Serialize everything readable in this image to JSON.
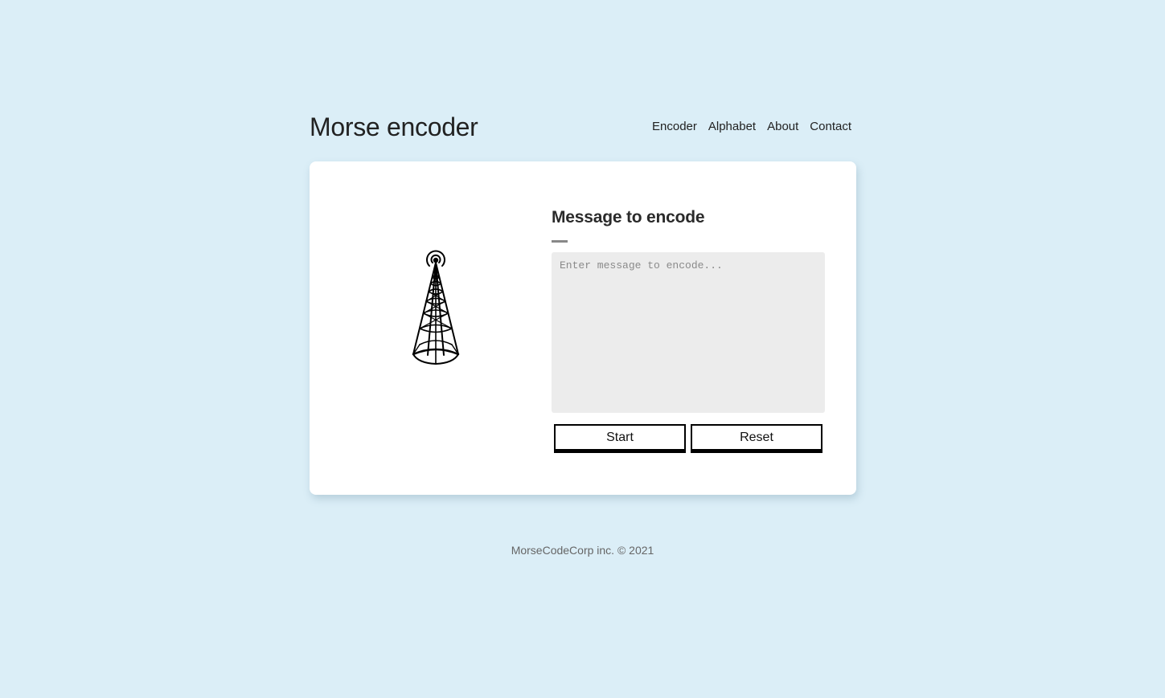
{
  "header": {
    "site_title": "Morse encoder",
    "nav": [
      "Encoder",
      "Alphabet",
      "About",
      "Contact"
    ]
  },
  "main": {
    "illustration_icon": "radio-tower-icon",
    "form_title": "Message to encode",
    "message_input": {
      "placeholder": "Enter message to encode...",
      "value": ""
    },
    "start_label": "Start",
    "reset_label": "Reset"
  },
  "footer": {
    "text": "MorseCodeCorp inc. © 2021"
  },
  "colors": {
    "background": "#dbeef7",
    "card": "#ffffff",
    "input_background": "#ececec",
    "button_border": "#000000"
  }
}
